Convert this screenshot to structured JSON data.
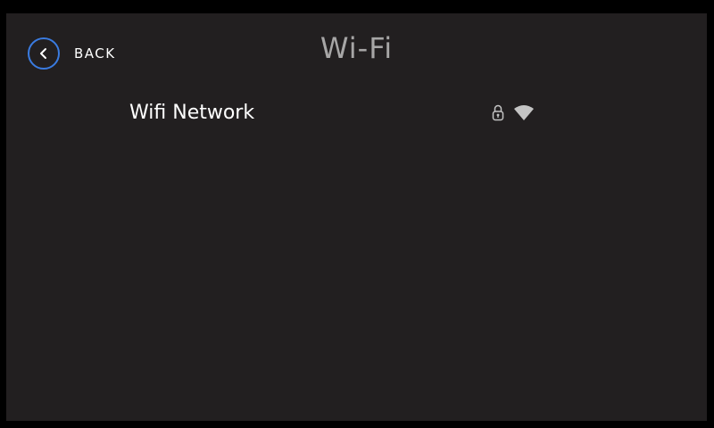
{
  "header": {
    "back_label": "BACK",
    "title": "Wi-Fi"
  },
  "networks": [
    {
      "name": "Wifi Network",
      "secured_icon": "lock-icon",
      "signal_icon": "wifi-signal-icon"
    }
  ],
  "colors": {
    "background": "#221f20",
    "accent": "#3a7be0",
    "title": "#a7a6a6",
    "text": "#ffffff",
    "icon": "#c4c4c4"
  }
}
